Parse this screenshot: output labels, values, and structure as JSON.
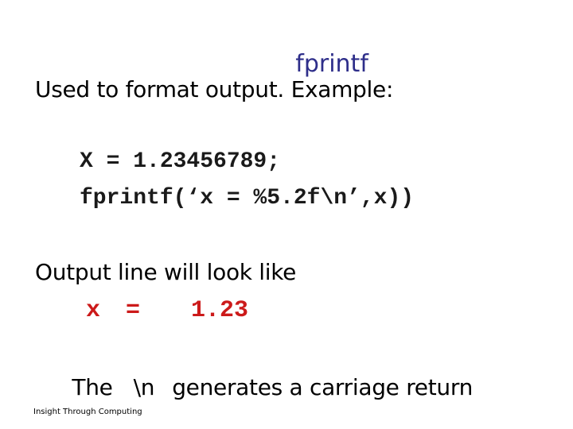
{
  "slide": {
    "title": "fprintf",
    "intro": "Used to format output. Example:",
    "code_lines": [
      "X = 1.23456789;",
      "fprintf(‘x = %5.2f\\n’,x))"
    ],
    "output_label": "Output line will look like",
    "output_example": "x =  1.23",
    "newline_note": {
      "prefix": "The",
      "token": "\\n",
      "suffix": "generates a carriage return"
    },
    "footer": "Insight Through Computing"
  },
  "colors": {
    "title": "#2e2e8a",
    "output_example": "#cc1a1a",
    "text": "#000000"
  }
}
